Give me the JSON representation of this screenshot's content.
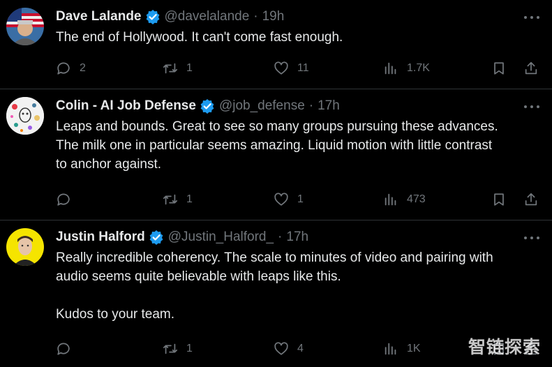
{
  "tweets": [
    {
      "name": "Dave Lalande",
      "handle": "@davelalande",
      "separator": "·",
      "time": "19h",
      "lines": [
        "The end of Hollywood.  It can't come fast enough."
      ],
      "replies": "2",
      "retweets": "1",
      "likes": "11",
      "views": "1.7K"
    },
    {
      "name": "Colin - AI Job Defense",
      "handle": "@job_defense",
      "separator": "·",
      "time": "17h",
      "lines": [
        "Leaps and bounds. Great to see so many groups pursuing these advances.",
        "The milk one in particular seems amazing. Liquid motion with little contrast",
        "to anchor against."
      ],
      "replies": "",
      "retweets": "1",
      "likes": "1",
      "views": "473"
    },
    {
      "name": "Justin Halford",
      "handle": "@Justin_Halford_",
      "separator": "·",
      "time": "17h",
      "lines": [
        "Really incredible coherency. The scale to minutes of video and pairing with",
        "audio seems quite believable with leaps like this.",
        "Kudos to your team."
      ],
      "replies": "",
      "retweets": "1",
      "likes": "4",
      "views": "1K"
    }
  ],
  "watermark": "智链探索",
  "icons": {
    "verified": "verified-badge-icon",
    "more": "more-dots-icon",
    "reply": "reply-icon",
    "retweet": "retweet-icon",
    "like": "heart-icon",
    "views": "views-icon",
    "bookmark": "bookmark-icon",
    "share": "share-icon"
  },
  "colors": {
    "background": "#000000",
    "text": "#e7e9ea",
    "muted": "#71767b",
    "verified": "#1d9bf0",
    "divider": "#2f3336"
  }
}
